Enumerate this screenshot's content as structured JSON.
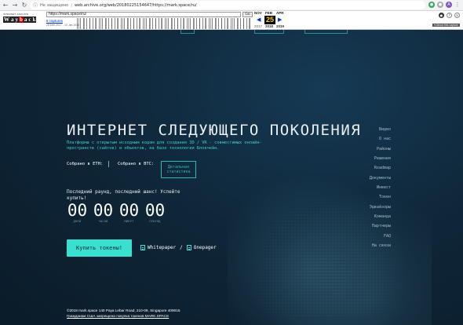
{
  "browser": {
    "security_label": "Не защищено",
    "url": "web.archive.org/web/20180225154647/https://mark.space/ru/"
  },
  "wayback": {
    "logo_top": "INTERNET ARCHIVE",
    "logo_letters": [
      "W",
      "a",
      "y",
      "b",
      "a",
      "c",
      "k",
      "M",
      "a",
      "c",
      "h",
      "i",
      "n",
      "e"
    ],
    "url_value": "https://mark.space/ru/",
    "go_label": "Go",
    "captures": "6 captures",
    "dates": "28 Dec 2017 - 10 Jan 2018",
    "months": {
      "prev": "NOV",
      "current": "FEB",
      "next": "APR"
    },
    "day": "25",
    "years": {
      "prev": "2017",
      "current": "2018",
      "next": "2019"
    },
    "about": "▾ About this capture"
  },
  "hero": {
    "headline": "ИНТЕРНЕТ СЛЕДУЮЩЕГО ПОКОЛЕНИЯ",
    "subline": "Платформа с открытым исходным кодом для создания 3D / VR - совместимых онлайн-пространств (сайтов) и объектов, на базе технологии Блокчейн.",
    "collected_eth": "Собрано в ETH:",
    "collected_btc": "Собрано в BTC:",
    "stats_button": "Детальная статистика",
    "last_round": "Последний раунд, последний шанс! Успейте купить!",
    "countdown": [
      {
        "value": "00",
        "label": "ДНЕЙ"
      },
      {
        "value": "00",
        "label": "ЧАСОВ"
      },
      {
        "value": "00",
        "label": "МИНУТ"
      },
      {
        "value": "00",
        "label": "СЕКУНД"
      }
    ],
    "buy_button": "Купить токены!",
    "whitepaper": "Whitepaper",
    "slash": "/",
    "onepager": "Onepager"
  },
  "sidenav": {
    "items": [
      "Видео",
      "О нас",
      "Районы",
      "Решения",
      "Roadmap",
      "Документы",
      "Инвест",
      "Токен",
      "Эдвайзоры",
      "Команда",
      "Партнеры",
      "FAQ",
      "На связи"
    ]
  },
  "footer": {
    "address": "©2018 mark.space   140 Paya Lebar Road, 210-09, Singapore 409015",
    "notice": "Гражданам США запрещена покупка токенов MARK.SPACE"
  }
}
